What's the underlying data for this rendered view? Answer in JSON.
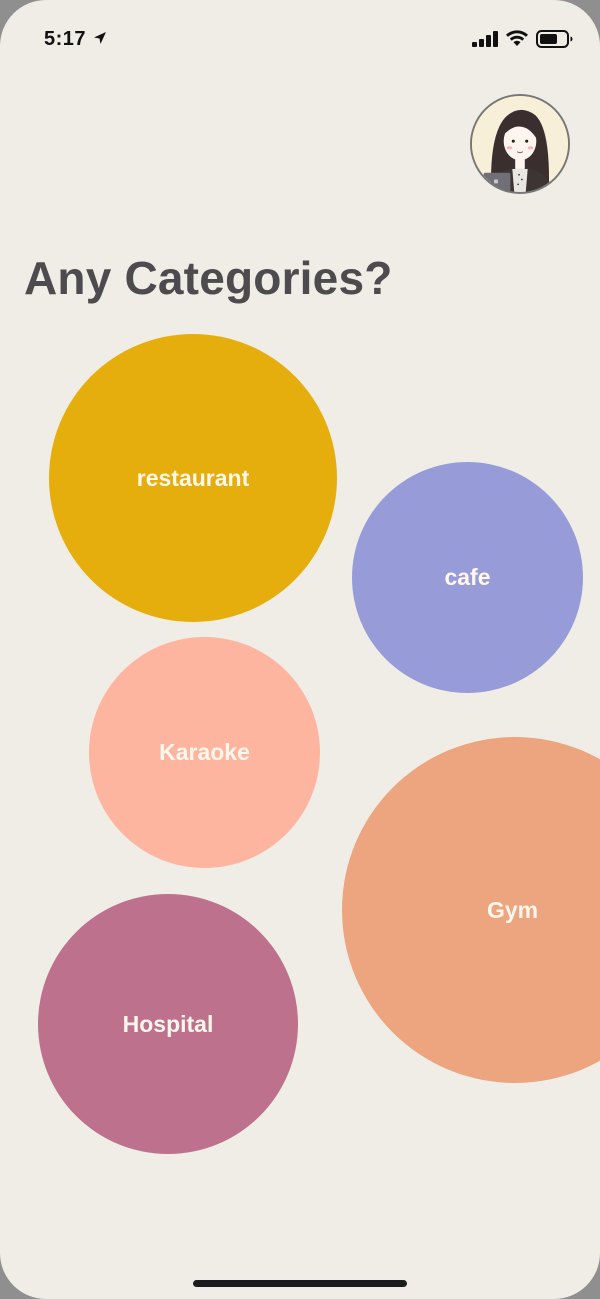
{
  "status_bar": {
    "time": "5:17",
    "icons": [
      "location-arrow-icon",
      "cellular-signal-icon",
      "wifi-icon",
      "battery-icon"
    ]
  },
  "profile": {
    "icon": "avatar-illustration"
  },
  "header": {
    "title": "Any Categories?"
  },
  "categories": [
    {
      "label": "restaurant",
      "color": "#e5ae0c"
    },
    {
      "label": "cafe",
      "color": "#979cd9"
    },
    {
      "label": "Karaoke",
      "color": "#fdb5a0"
    },
    {
      "label": "Gym",
      "color": "#eca57e"
    },
    {
      "label": "Hospital",
      "color": "#be718d"
    }
  ],
  "colors": {
    "background": "#f0ede6",
    "title": "#4d4b4d",
    "bubble_text": "#fff7ec"
  }
}
